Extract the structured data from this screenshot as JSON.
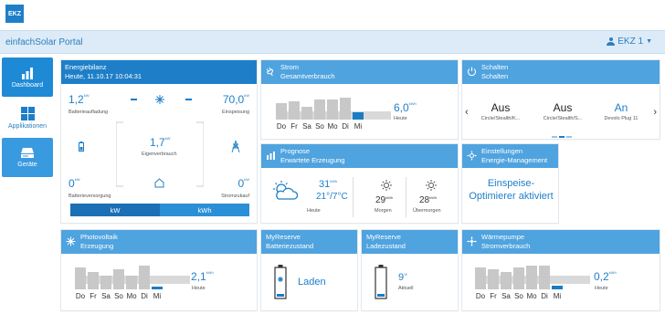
{
  "brand": {
    "logo": "EKZ",
    "portal_title": "einfachSolar Portal",
    "user": "EKZ 1",
    "accent": "#1e7fc8",
    "header_light": "#4fa3df"
  },
  "nav": [
    {
      "label": "Dashboard",
      "icon": "bar-chart-icon"
    },
    {
      "label": "Applikationen",
      "icon": "grid-icon"
    },
    {
      "label": "Geräte",
      "icon": "device-icon"
    }
  ],
  "energiebilanz": {
    "title": "Energiebilanz",
    "subtitle": "Heute, 11.10.17 10:04:31",
    "batterieaufladung": {
      "value": "1,2",
      "unit": "kW",
      "label": "Batterieaufladung"
    },
    "einspeisung": {
      "value": "70,0",
      "unit": "kW",
      "label": "Einspeisung"
    },
    "eigenverbrauch": {
      "value": "1,7",
      "unit": "kW",
      "label": "Eigenverbrauch"
    },
    "batterieversorgung": {
      "value": "0",
      "unit": "kW",
      "label": "Batterieversorgung"
    },
    "stromzukauf": {
      "value": "0",
      "unit": "kW",
      "label": "Stromzukauf"
    },
    "toggle": [
      "kW",
      "kWh"
    ]
  },
  "strom": {
    "title": "Strom",
    "subtitle": "Gesamtverbrauch",
    "value": "6,0",
    "unit": "kWh",
    "label": "Heute",
    "days": [
      "Do",
      "Fr",
      "Sa",
      "So",
      "Mo",
      "Di",
      "Mi"
    ],
    "chart_data": {
      "type": "bar",
      "categories": [
        "Do",
        "Fr",
        "Sa",
        "So",
        "Mo",
        "Di",
        "Mi"
      ],
      "values": [
        15,
        17,
        12,
        18,
        18,
        20,
        7
      ],
      "ylim": [
        0,
        20
      ]
    }
  },
  "schalten": {
    "title": "Schalten",
    "subtitle": "Schalten",
    "items": [
      {
        "state": "Aus",
        "name": "Circle/Stealth/K..."
      },
      {
        "state": "Aus",
        "name": "Circle/Stealth/S..."
      },
      {
        "state": "An",
        "name": "Devolo Plug 11"
      }
    ],
    "prev": "‹",
    "next": "›"
  },
  "prognose": {
    "title": "Prognose",
    "subtitle": "Erwartete Erzeugung",
    "today": {
      "value": "31",
      "unit": "kWh",
      "temp": "21°/7°C",
      "label": "Heute"
    },
    "morgen": {
      "value": "29",
      "unit": "kWh",
      "label": "Morgen"
    },
    "uebermorgen": {
      "value": "28",
      "unit": "kWh",
      "label": "Übermorgen"
    }
  },
  "einstellungen": {
    "title": "Einstellungen",
    "subtitle": "Energie-Management",
    "status": "Einspeise-Optimierer aktiviert"
  },
  "photovoltaik": {
    "title": "Photovoltaik",
    "subtitle": "Erzeugung",
    "value": "2,1",
    "unit": "kWh",
    "label": "Heute",
    "days": [
      "Do",
      "Fr",
      "Sa",
      "So",
      "Mo",
      "Di",
      "Mi"
    ],
    "chart_data": {
      "type": "bar",
      "categories": [
        "Do",
        "Fr",
        "Sa",
        "So",
        "Mo",
        "Di",
        "Mi"
      ],
      "values": [
        22,
        18,
        14,
        20,
        14,
        24,
        3
      ],
      "ylim": [
        0,
        24
      ]
    }
  },
  "myreserve_batt": {
    "title": "MyReserve",
    "subtitle": "Batteriezustand",
    "status": "Laden"
  },
  "myreserve_lade": {
    "title": "MyReserve",
    "subtitle": "Ladezustand",
    "value": "9",
    "unit": "%",
    "label": "Aktuell"
  },
  "waermepumpe": {
    "title": "Wärmepumpe",
    "subtitle": "Stromverbrauch",
    "value": "0,2",
    "unit": "kWh",
    "label": "Heute",
    "days": [
      "Do",
      "Fr",
      "Sa",
      "So",
      "Mo",
      "Di",
      "Mi"
    ],
    "chart_data": {
      "type": "bar",
      "categories": [
        "Do",
        "Fr",
        "Sa",
        "So",
        "Mo",
        "Di",
        "Mi"
      ],
      "values": [
        22,
        20,
        18,
        22,
        24,
        24,
        4
      ],
      "ylim": [
        0,
        24
      ]
    }
  }
}
